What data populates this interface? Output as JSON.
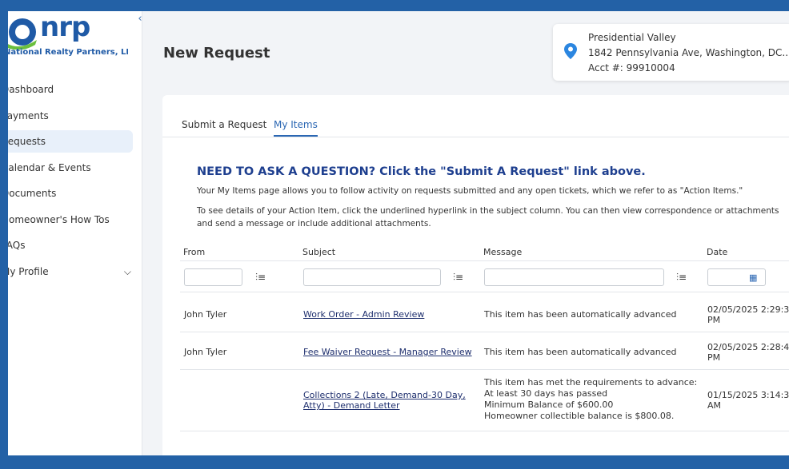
{
  "brand": {
    "logo_text": "nrp",
    "company": "National Realty Partners, LLC",
    "color": "#1f5aa6"
  },
  "sidebar": {
    "collapse_icon": "chevron-left-icon",
    "items": [
      {
        "label": "Dashboard"
      },
      {
        "label": "Payments"
      },
      {
        "label": "Requests"
      },
      {
        "label": "Calendar & Events"
      },
      {
        "label": "Documents"
      },
      {
        "label": "Homeowner's How Tos"
      },
      {
        "label": "FAQs"
      },
      {
        "label": "My Profile"
      }
    ],
    "active_index": 2
  },
  "header": {
    "title": "New Request"
  },
  "property": {
    "name": "Presidential Valley",
    "address": "1842 Pennsylvania Ave, Washington, DC...",
    "account": "Acct #: 99910004",
    "pin_color": "#2b86e0"
  },
  "tabs": [
    {
      "label": "Submit a Request"
    },
    {
      "label": "My Items"
    }
  ],
  "content": {
    "heading": "NEED TO ASK A QUESTION?  Click the \"Submit A Request\" link above.",
    "para1": "Your My Items page allows you to follow activity on requests submitted and any open tickets, which we refer to as \"Action Items.\"",
    "para2": "To see details of your Action Item, click the underlined hyperlink in the subject column.  You can then view correspondence or attachments and send a message or include additional attachments."
  },
  "table": {
    "columns": [
      "From",
      "Subject",
      "Message",
      "Date"
    ],
    "rows": [
      {
        "from": "John Tyler",
        "subject": "Work Order - Admin Review",
        "message": "This item has been automatically advanced",
        "date": "02/05/2025 2:29:3\nPM"
      },
      {
        "from": "John Tyler",
        "subject": "Fee Waiver Request - Manager Review",
        "message": "This item has been automatically advanced",
        "date": "02/05/2025 2:28:4\nPM"
      },
      {
        "from": "",
        "subject": "Collections 2 (Late, Demand-30 Day,\nAtty) - Demand Letter",
        "message": "This item has met the requirements to advance:\nAt least 30 days has passed\nMinimum Balance of $600.00\nHomeowner collectible balance is $800.08.",
        "date": "01/15/2025 3:14:3\nAM"
      }
    ]
  }
}
